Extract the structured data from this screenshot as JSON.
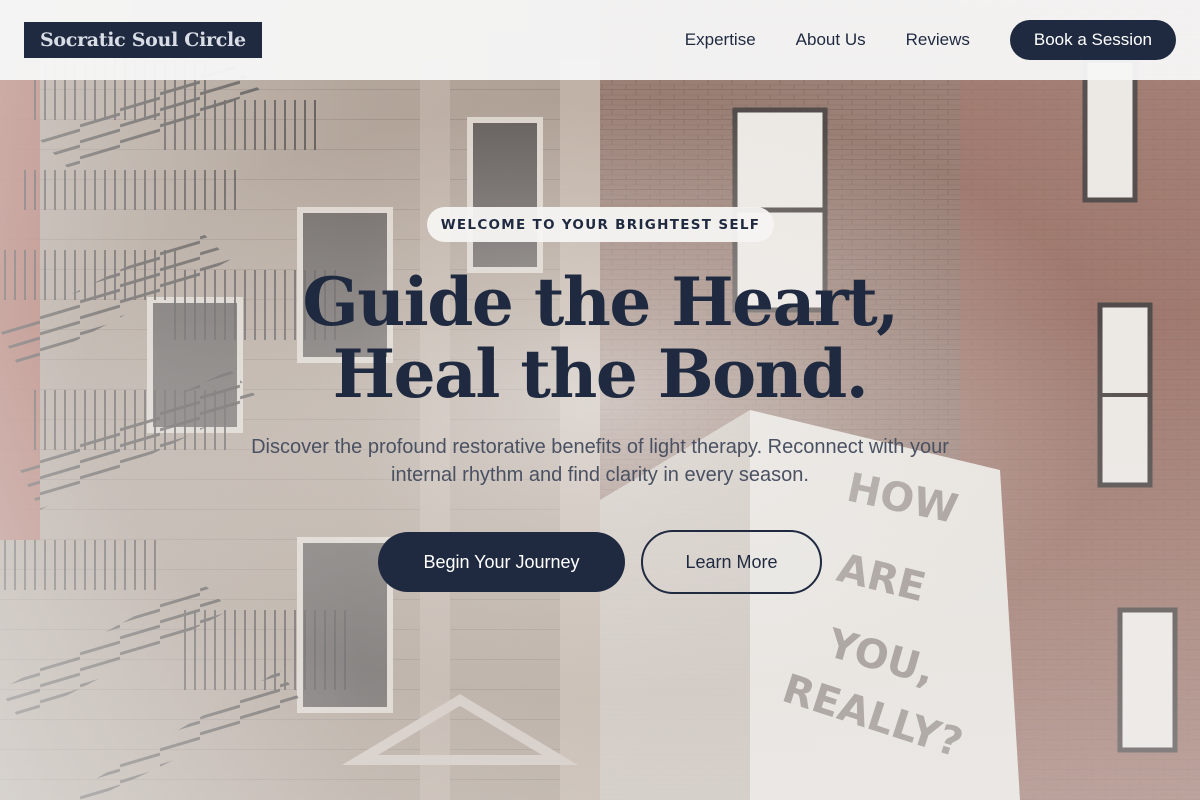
{
  "header": {
    "logo_text": "Socratic Soul Circle",
    "nav": [
      {
        "label": "Expertise"
      },
      {
        "label": "About Us"
      },
      {
        "label": "Reviews"
      }
    ],
    "cta_label": "Book a Session"
  },
  "hero": {
    "badge": "WELCOME TO YOUR BRIGHTEST SELF",
    "headline_line1": "Guide the Heart,",
    "headline_line2": "Heal the Bond.",
    "subtitle": "Discover the profound restorative benefits of light therapy. Reconnect with your internal rhythm and find clarity in every season.",
    "primary_cta": "Begin Your Journey",
    "secondary_cta": "Learn More"
  },
  "background": {
    "mural_lines": [
      "HOW",
      "ARE",
      "YOU,",
      "REALLY?"
    ]
  },
  "colors": {
    "brand_navy": "#1f2a40",
    "text_muted": "#4a5162",
    "header_bg": "#f6f6f6"
  }
}
